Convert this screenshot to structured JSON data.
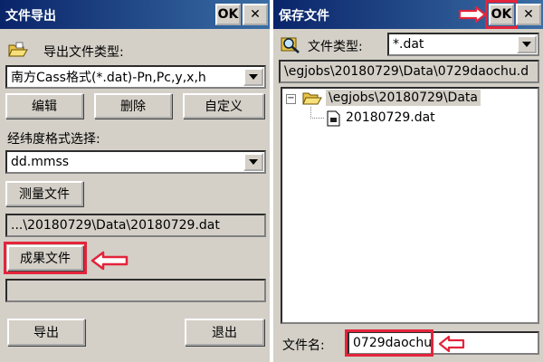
{
  "export_dialog": {
    "title": "文件导出",
    "ok_label": "OK",
    "close_label": "✕",
    "export_type_label": "导出文件类型:",
    "export_type_value": "南方Cass格式(*.dat)-Pn,Pc,y,x,h",
    "edit_label": "编辑",
    "delete_label": "删除",
    "custom_label": "自定义",
    "latlon_format_label": "经纬度格式选择:",
    "latlon_format_value": "dd.mmss",
    "survey_file_label": "测量文件",
    "survey_file_path": "...\\20180729\\Data\\20180729.dat",
    "result_file_label": "成果文件",
    "result_file_path": "",
    "export_label": "导出",
    "exit_label": "退出"
  },
  "save_dialog": {
    "title": "保存文件",
    "ok_label": "OK",
    "close_label": "✕",
    "file_type_label": "文件类型:",
    "file_type_value": "*.dat",
    "current_path": "\\egjobs\\20180729\\Data\\0729daochu.d",
    "tree": {
      "folder": "\\egjobs\\20180729\\Data",
      "expander": "−",
      "files": [
        "20180729.dat"
      ]
    },
    "filename_label": "文件名:",
    "filename_value": "0729daochu"
  },
  "colors": {
    "title_bar": "#0a246a",
    "highlight_box": "#e3243b",
    "panel": "#d4d0c8"
  }
}
